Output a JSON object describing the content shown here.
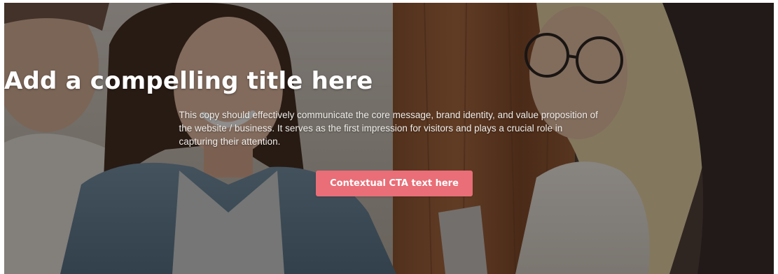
{
  "hero": {
    "title": "Add a compelling title here",
    "copy": "This copy should effectively communicate the core message, brand identity, and value proposition of the website / business. It serves as the first impression for visitors and plays a crucial role in capturing their attention.",
    "cta_label": "Contextual CTA text here"
  },
  "colors": {
    "cta_background": "#e96e77",
    "title_text": "#ffffff",
    "overlay": "#14100e"
  }
}
